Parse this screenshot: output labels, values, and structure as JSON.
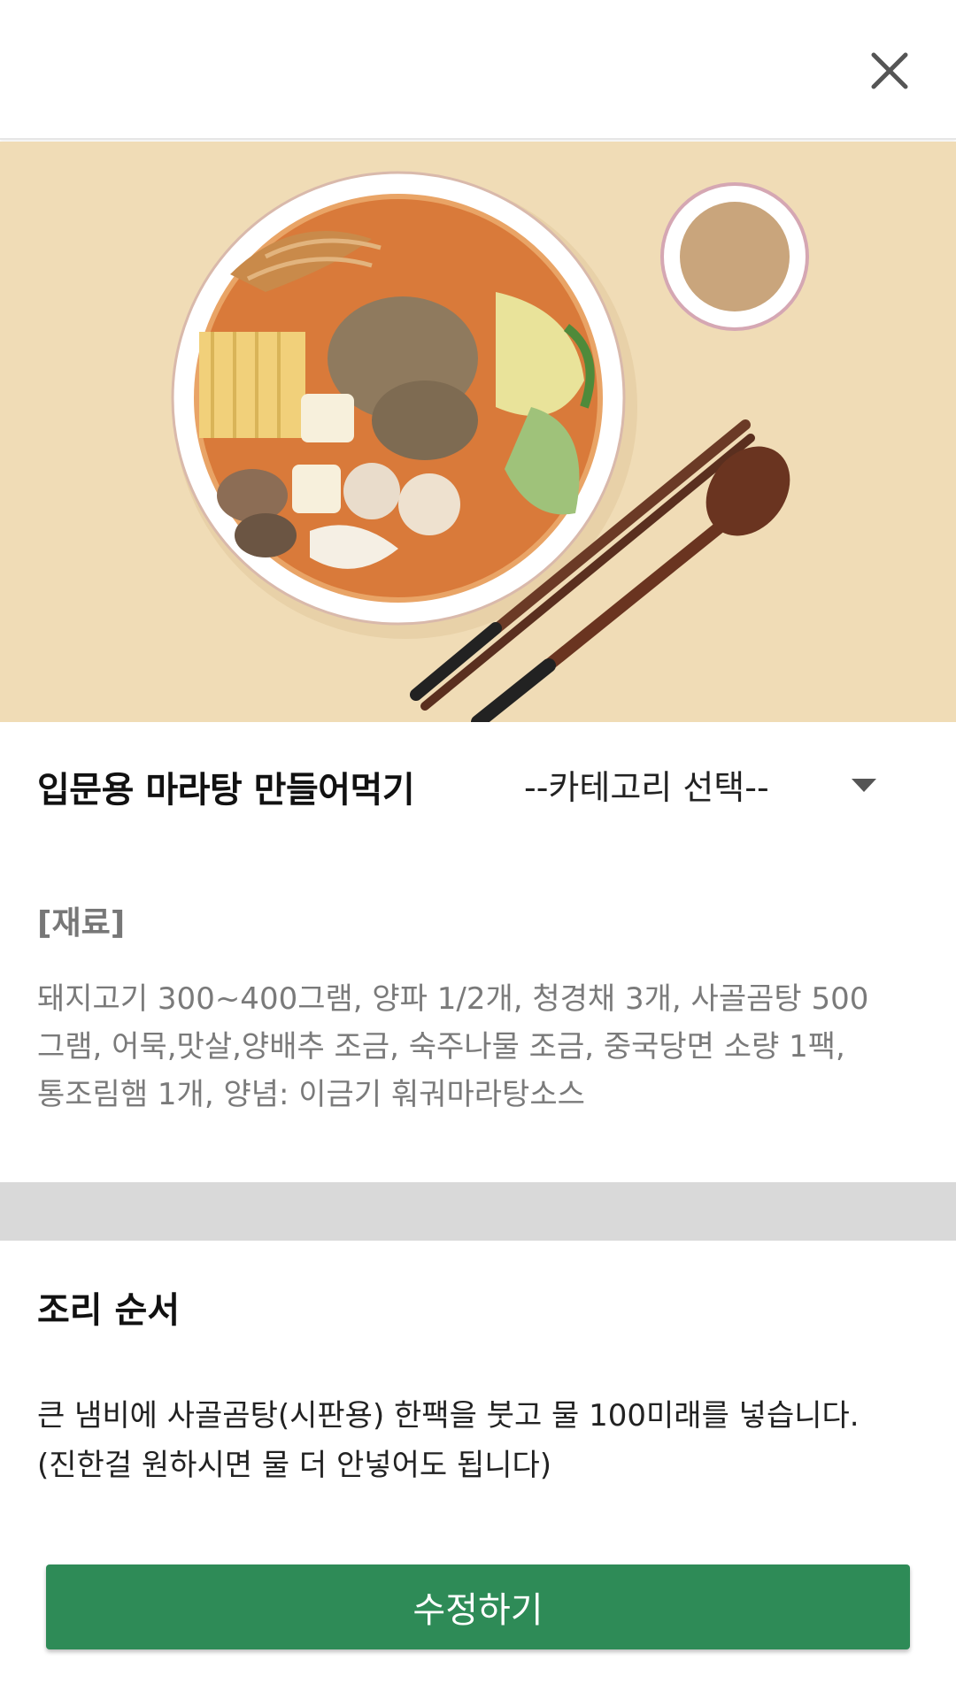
{
  "header": {
    "close_icon": "close-icon"
  },
  "recipe": {
    "title": "입문용 마라탕 만들어먹기",
    "category_placeholder": "--카테고리 선택--"
  },
  "ingredients": {
    "heading": "[재료]",
    "lines": [
      "돼지고기 300~400그램, 양파 1/2개, 청경채 3개, 사골곰탕 500",
      "그램, 어묵,맛살,양배추 조금, 숙주나물 조금, 중국당면 소량 1팩,",
      "통조림햄 1개, 양념: 이금기 훠궈마라탕소스"
    ]
  },
  "steps": {
    "heading": "조리 순서",
    "lines": [
      "큰 냄비에 사골곰탕(시판용) 한팩을 붓고 물 100미래를 넣습니다.",
      "(진한걸 원하시면 물 더 안넣어도 됩니다)"
    ]
  },
  "actions": {
    "edit_label": "수정하기"
  },
  "colors": {
    "accent_green": "#2e8b57",
    "hero_background": "#f0dcb6",
    "divider": "#d9d9d9"
  }
}
